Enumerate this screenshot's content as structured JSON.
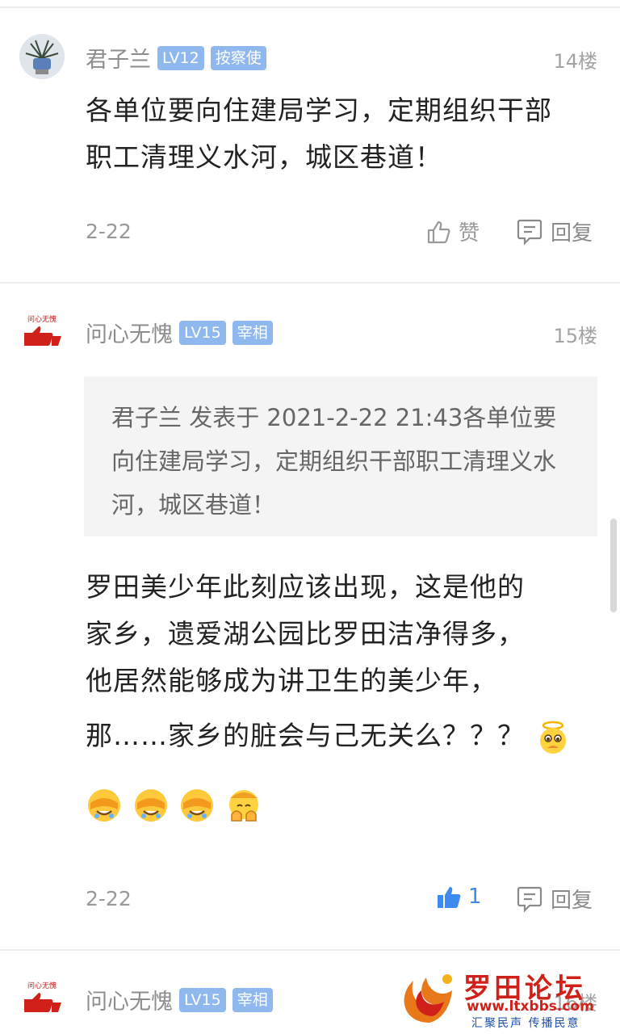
{
  "posts": [
    {
      "username": "君子兰",
      "level": "LV12",
      "title": "按察使",
      "floor": "14楼",
      "content": "各单位要向住建局学习，定期组织干部职工清理义水河，城区巷道！",
      "date": "2-22",
      "like_label": "赞",
      "reply_label": "回复"
    },
    {
      "username": "问心无愧",
      "level": "LV15",
      "title": "宰相",
      "floor": "15楼",
      "quote": "君子兰 发表于 2021-2-22 21:43各单位要向住建局学习，定期组织干部职工清理义水河，城区巷道！",
      "content_lines": [
        "罗田美少年此刻应该出现，这是他的",
        "家乡，遗爱湖公园比罗田洁净得多，",
        "他居然能够成为讲卫生的美少年，",
        "那……家乡的脏会与己无关么？？？"
      ],
      "date": "2-22",
      "like_count": "1",
      "reply_label": "回复"
    },
    {
      "username": "问心无愧",
      "level": "LV15",
      "title": "宰相",
      "floor": "16楼"
    }
  ],
  "watermark": {
    "name": "罗田论坛",
    "url": "www.ltxbbs.com",
    "slogan": "汇聚民声 传播民意"
  },
  "colors": {
    "badge": "#8fb9ee",
    "like_active": "#3d8af0",
    "watermark_red": "#d0201a"
  }
}
